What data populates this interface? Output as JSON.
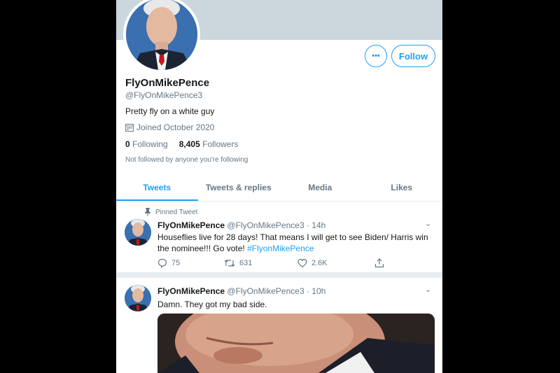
{
  "profile": {
    "name": "FlyOnMikePence",
    "handle": "@FlyOnMikePence3",
    "bio": "Pretty fly on a white guy",
    "joined": "Joined October 2020",
    "following_count": "0",
    "following_label": "Following",
    "followers_count": "8,405",
    "followers_label": "Followers",
    "not_followed": "Not followed by anyone you're following",
    "more_label": "•••",
    "follow_label": "Follow"
  },
  "tabs": [
    {
      "label": "Tweets",
      "active": true
    },
    {
      "label": "Tweets & replies",
      "active": false
    },
    {
      "label": "Media",
      "active": false
    },
    {
      "label": "Likes",
      "active": false
    }
  ],
  "tweets": [
    {
      "pinned_label": "Pinned Tweet",
      "name": "FlyOnMikePence",
      "handle": "@FlyOnMikePence3",
      "time": "· 14h",
      "text": "Houseflies live for 28 days! That means I will get to see Biden/ Harris win the nominee!!! Go vote! ",
      "hashtag": "#FlyonMikePence",
      "replies": "75",
      "retweets": "631",
      "likes": "2.6K"
    },
    {
      "name": "FlyOnMikePence",
      "handle": "@FlyOnMikePence3",
      "time": "· 10h",
      "text": "Damn. They got my bad side."
    }
  ],
  "colors": {
    "accent": "#1da1f2",
    "banner": "#ccd6dd",
    "muted": "#657786"
  }
}
